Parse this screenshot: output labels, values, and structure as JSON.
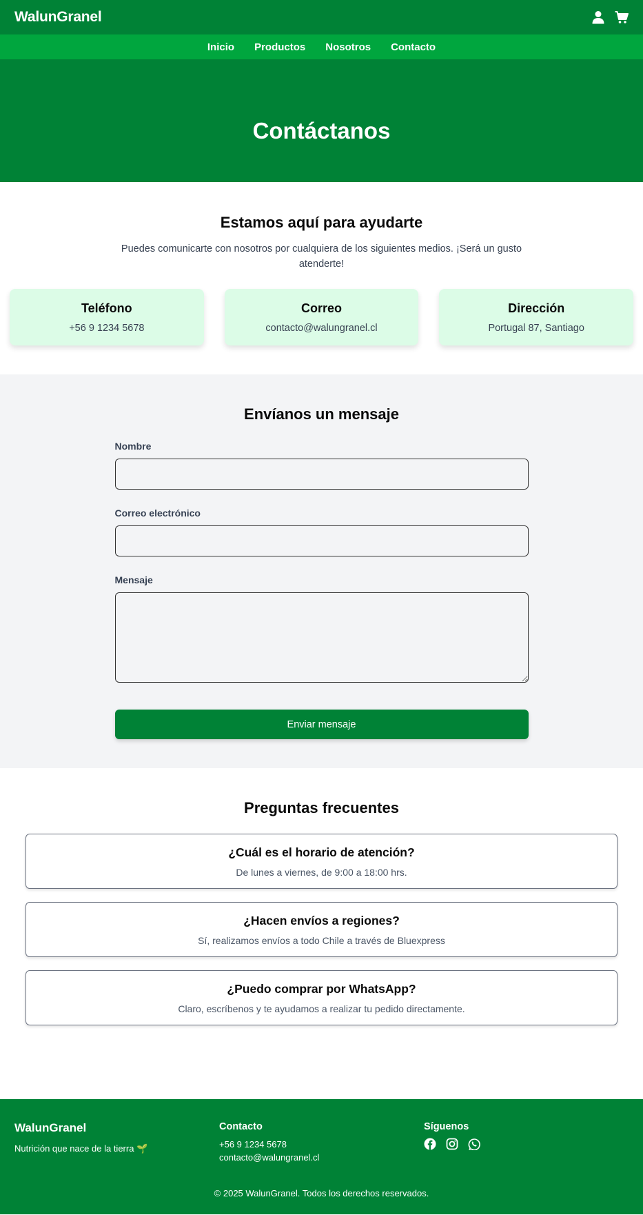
{
  "header": {
    "brand": "WalunGranel",
    "user_icon": "user-icon",
    "cart_icon": "shopping-cart-icon"
  },
  "nav": {
    "items": [
      {
        "label": "Inicio"
      },
      {
        "label": "Productos"
      },
      {
        "label": "Nosotros"
      },
      {
        "label": "Contacto"
      }
    ]
  },
  "hero": {
    "title": "Contáctanos"
  },
  "intro": {
    "heading": "Estamos aquí para ayudarte",
    "text": "Puedes comunicarte con nosotros por cualquiera de los siguientes medios. ¡Será un gusto atenderte!",
    "cards": [
      {
        "title": "Teléfono",
        "value": "+56 9 1234 5678"
      },
      {
        "title": "Correo",
        "value": "contacto@walungranel.cl"
      },
      {
        "title": "Dirección",
        "value": "Portugal 87, Santiago"
      }
    ]
  },
  "form": {
    "heading": "Envíanos un mensaje",
    "name_label": "Nombre",
    "name_value": "",
    "email_label": "Correo electrónico",
    "email_value": "",
    "message_label": "Mensaje",
    "message_value": "",
    "submit_label": "Enviar mensaje"
  },
  "faq": {
    "heading": "Preguntas frecuentes",
    "items": [
      {
        "q": "¿Cuál es el horario de atención?",
        "a": "De lunes a viernes, de 9:00 a 18:00 hrs."
      },
      {
        "q": "¿Hacen envíos a regiones?",
        "a": "Sí, realizamos envíos a todo Chile a través de Bluexpress"
      },
      {
        "q": "¿Puedo comprar por WhatsApp?",
        "a": "Claro, escríbenos y te ayudamos a realizar tu pedido directamente."
      }
    ]
  },
  "footer": {
    "brand": "WalunGranel",
    "tagline": "Nutrición que nace de la tierra 🌱",
    "contact_title": "Contacto",
    "phone": "+56 9 1234 5678",
    "email": "contacto@walungranel.cl",
    "social_title": "Síguenos",
    "social_icons": [
      "facebook-icon",
      "instagram-icon",
      "whatsapp-icon"
    ],
    "copyright": "© 2025 WalunGranel. Todos los derechos reservados."
  },
  "colors": {
    "primary": "#008236",
    "nav": "#00a63e",
    "card_bg": "#dcfce7",
    "form_bg": "#f3f4f6"
  }
}
